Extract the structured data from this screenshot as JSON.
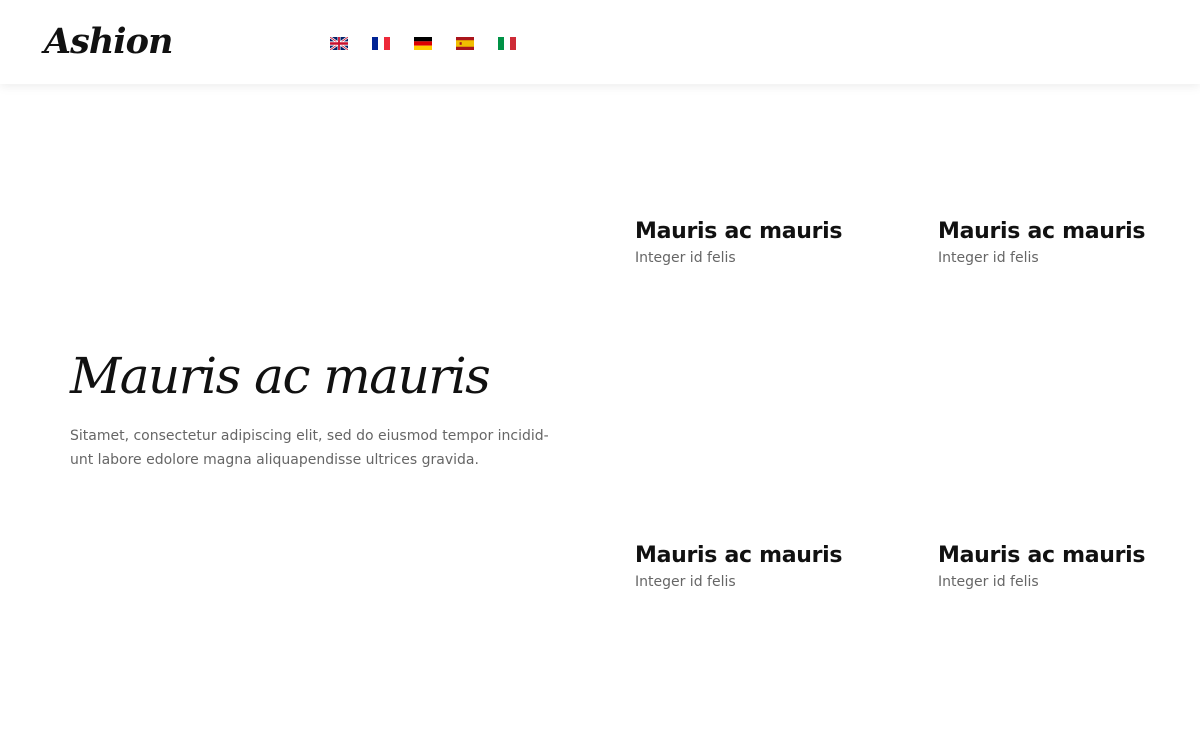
{
  "header": {
    "logo": "Ashion",
    "languages": [
      {
        "code": "en",
        "name": "English"
      },
      {
        "code": "fr",
        "name": "French"
      },
      {
        "code": "de",
        "name": "German"
      },
      {
        "code": "es",
        "name": "Spanish"
      },
      {
        "code": "it",
        "name": "Italian"
      }
    ]
  },
  "hero": {
    "title": "Mauris ac mauris",
    "text": "Sitamet, consectetur adipiscing elit, sed do eiusmod tempor incidid-unt labore edolore magna aliquapendisse ultrices gravida."
  },
  "categories": [
    {
      "title": "Mauris ac mauris",
      "subtitle": "Integer id felis"
    },
    {
      "title": "Mauris ac mauris",
      "subtitle": "Integer id felis"
    },
    {
      "title": "Mauris ac mauris",
      "subtitle": "Integer id felis"
    },
    {
      "title": "Mauris ac mauris",
      "subtitle": "Integer id felis"
    }
  ]
}
